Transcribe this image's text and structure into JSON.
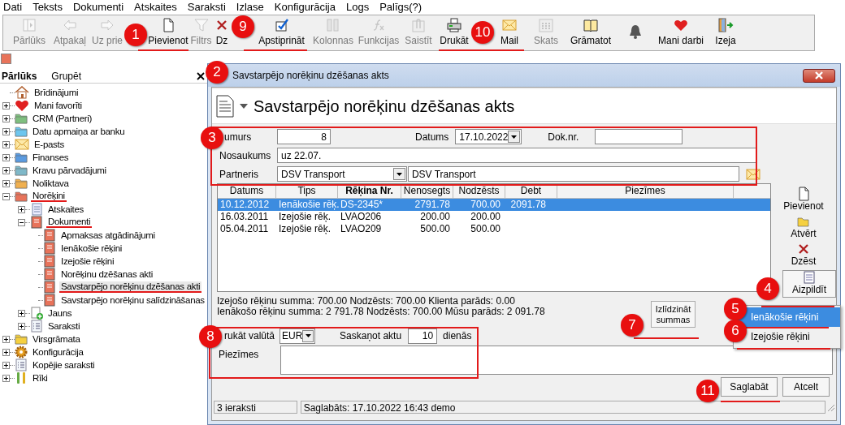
{
  "menu": [
    "Dati",
    "Teksts",
    "Dokumenti",
    "Atskaites",
    "Saraksti",
    "Izlase",
    "Konfigurācija",
    "Logs",
    "Palīgs(?)"
  ],
  "toolbar": [
    {
      "label": "Pārlūks",
      "disabled": true,
      "kind": "panel"
    },
    {
      "label": "Atpakaļ",
      "disabled": true,
      "kind": "back"
    },
    {
      "label": "Uz prie",
      "disabled": true,
      "kind": "forward"
    },
    {
      "label": "Pievienot",
      "disabled": false,
      "kind": "page"
    },
    {
      "label": "Filtrs",
      "disabled": true,
      "kind": "filter"
    },
    {
      "label": "Dz",
      "disabled": false,
      "kind": "delete"
    },
    {
      "label": "Apstiprināt",
      "disabled": false,
      "kind": "check"
    },
    {
      "label": "Kolonnas",
      "disabled": true,
      "kind": "columns"
    },
    {
      "label": "Funkcijas",
      "disabled": true,
      "kind": "function"
    },
    {
      "label": "Saistīt",
      "disabled": true,
      "kind": "clip"
    },
    {
      "label": "Drukāt",
      "disabled": false,
      "kind": "printer"
    },
    {
      "label": "Mail",
      "disabled": false,
      "kind": "mail"
    },
    {
      "label": "Skats",
      "disabled": true,
      "kind": "grid"
    },
    {
      "label": "Grāmatot",
      "disabled": false,
      "kind": "book"
    },
    {
      "disabled": false,
      "kind": "bell"
    },
    {
      "label": "Mani darbi",
      "disabled": false,
      "kind": "heart"
    },
    {
      "label": "Izeja",
      "disabled": false,
      "kind": "exit"
    }
  ],
  "browser": {
    "tabs": [
      {
        "label": "Pārlūks",
        "selected": true
      },
      {
        "label": "Grupēt",
        "selected": false
      }
    ],
    "tree": [
      {
        "label": "Brīdinājumi",
        "kind": "home",
        "selected": false,
        "underlined": false
      },
      {
        "label": "Mani favorīti",
        "kind": "heart",
        "expanded": false,
        "selected": false,
        "underlined": false
      },
      {
        "label": "CRM (Partneri)",
        "kind": "folder",
        "color": "#7fbf7f",
        "expanded": false,
        "selected": false,
        "underlined": false
      },
      {
        "label": "Datu apmaiņa ar banku",
        "kind": "folder",
        "color": "#6ec6ee",
        "expanded": false,
        "selected": false,
        "underlined": false
      },
      {
        "label": "E-pasts",
        "kind": "mail",
        "expanded": false,
        "selected": false,
        "underlined": false
      },
      {
        "label": "Finanses",
        "kind": "folder",
        "color": "#5b9be0",
        "expanded": false,
        "selected": false,
        "underlined": false
      },
      {
        "label": "Kravu pārvadājumi",
        "kind": "folder",
        "color": "#7fb8c8",
        "expanded": false,
        "selected": false,
        "underlined": false
      },
      {
        "label": "Noliktava",
        "kind": "folder",
        "color": "#f0b050",
        "expanded": false,
        "selected": false,
        "underlined": false
      },
      {
        "label": "Norēķini",
        "kind": "folder",
        "color": "#e8735a",
        "expanded": true,
        "selected": false,
        "underlined": true,
        "children": [
          {
            "label": "Atskaites",
            "kind": "report",
            "expanded": false,
            "selected": false,
            "underlined": false
          },
          {
            "label": "Dokumenti",
            "kind": "doc",
            "expanded": true,
            "selected": false,
            "underlined": true,
            "children": [
              {
                "label": "Apmaksas atgādinājumi",
                "kind": "doc",
                "selected": false,
                "underlined": false
              },
              {
                "label": "Ienākošie rēķini",
                "kind": "doc",
                "selected": false,
                "underlined": false
              },
              {
                "label": "Izejošie rēķini",
                "kind": "doc",
                "selected": false,
                "underlined": false
              },
              {
                "label": "Norēķinu dzēšanas akti",
                "kind": "doc",
                "selected": false,
                "underlined": false
              },
              {
                "label": "Savstarpējo norēķinu dzēšanas akti",
                "kind": "doc",
                "selected": true,
                "underlined": true
              },
              {
                "label": "Savstarpējo norēķinu salīdzināšanas",
                "kind": "doc",
                "selected": false,
                "underlined": false
              }
            ]
          },
          {
            "label": "Jauns",
            "kind": "new",
            "expanded": false,
            "selected": false,
            "underlined": false
          },
          {
            "label": "Saraksti",
            "kind": "list",
            "expanded": false,
            "selected": false,
            "underlined": false
          }
        ]
      },
      {
        "label": "Virsgrāmata",
        "kind": "folder",
        "color": "#f5d040",
        "expanded": false,
        "selected": false,
        "underlined": false
      },
      {
        "label": "Konfigurācija",
        "kind": "gear",
        "expanded": false,
        "selected": false,
        "underlined": false
      },
      {
        "label": "Kopējie saraksti",
        "kind": "list",
        "expanded": false,
        "selected": false,
        "underlined": false
      },
      {
        "label": "Rīki",
        "kind": "tools",
        "expanded": false,
        "selected": false,
        "underlined": false
      }
    ]
  },
  "dialog": {
    "title": "Savstarpējo norēķinu dzēšanas akts",
    "heading": "Savstarpējo norēķinu dzēšanas akts",
    "number": {
      "label": "umurs",
      "value": "8"
    },
    "date": {
      "label": "Datums",
      "value": "17.10.2022"
    },
    "doc_no": {
      "label": "Dok.nr."
    },
    "name": {
      "label": "Nosaukums",
      "value": "uz 22.07."
    },
    "partner": {
      "label": "Partneris",
      "code": "DSV Transport",
      "value": "DSV Transport"
    },
    "table": {
      "columns": [
        {
          "label": "Datums",
          "sorted": false
        },
        {
          "label": "Tips",
          "sorted": false
        },
        {
          "label": "Rēķina Nr.",
          "sorted": true
        },
        {
          "label": "Nenosegts",
          "sorted": false
        },
        {
          "label": "Nodzēsts",
          "sorted": false
        },
        {
          "label": "Debt",
          "sorted": false
        },
        {
          "label": "Piezīmes",
          "sorted": false
        }
      ],
      "rows": [
        {
          "cells": [
            "10.12.2012",
            "Ienākošie rēķ.",
            "DS-2345*",
            "2791.78",
            "700.00",
            "2091.78",
            ""
          ],
          "selected": true
        },
        {
          "cells": [
            "16.03.2011",
            "Izejošie rēķ.",
            "LVAO206",
            "200.00",
            "200.00",
            "",
            ""
          ],
          "selected": false
        },
        {
          "cells": [
            "05.04.2011",
            "Izejošie rēķ.",
            "LVAO209",
            "500.00",
            "500.00",
            "",
            ""
          ],
          "selected": false
        }
      ]
    },
    "side_buttons": [
      {
        "label": "Pievienot",
        "kind": "page"
      },
      {
        "label": "Atvērt",
        "kind": "open"
      },
      {
        "label": "Dzēst",
        "kind": "delete"
      },
      {
        "label": "Aizpildīt",
        "kind": "fill"
      }
    ],
    "popup": [
      {
        "label": "Ienākošie rēķini",
        "selected": true
      },
      {
        "label": "Izejošie rēķini",
        "selected": false
      }
    ],
    "summary": [
      "Izejošo rēķinu summa: 700.00 Nodzēsts: 700.00 Klienta parāds: 0.00",
      "Ienākošo rēķinu summa: 2 791.78 Nodzēsts: 700.00 Mūsu parāds: 2 091.78"
    ],
    "equalize_button": "Izlīdzināt summas",
    "currency": {
      "label": "rukāt valūtā",
      "value": "EUR"
    },
    "reconcile": {
      "label": "Saskaņot aktu",
      "value": "10",
      "unit": "dienās"
    },
    "notes": {
      "label": "Piezīmes"
    },
    "buttons": [
      "Saglabāt",
      "Atcelt"
    ],
    "status_bar": [
      "3 ieraksti",
      "Saglabāts: 17.10.2022 16:43 demo"
    ]
  },
  "callouts": [
    "1",
    "2",
    "3",
    "4",
    "5",
    "6",
    "7",
    "8",
    "9",
    "10",
    "11"
  ]
}
